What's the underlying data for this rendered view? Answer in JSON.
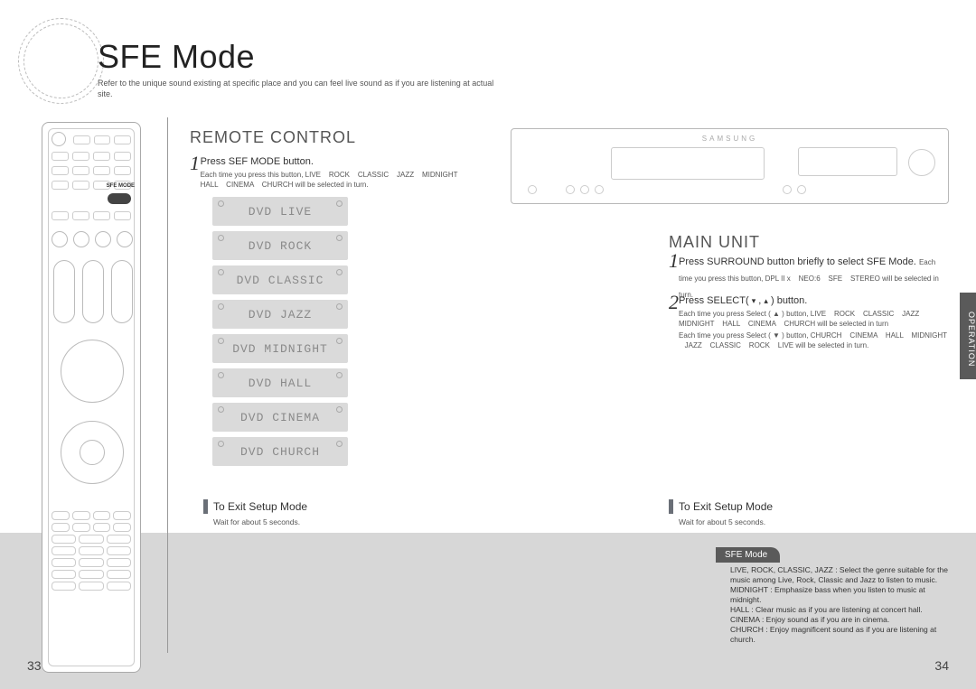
{
  "header": {
    "title": "SFE Mode",
    "subtitle": "Refer to the unique sound existing at specific place and you can feel live sound as if you are listening at actual site."
  },
  "remote_control": {
    "heading": "REMOTE CONTROL",
    "step1": {
      "num": "1",
      "text": "Press SEF MODE button.",
      "detail": "Each time you press this button, LIVE    ROCK    CLASSIC    JAZZ    MIDNIGHT    HALL    CINEMA    CHURCH will be selected in turn."
    },
    "sfe_button_label": "SFE MODE",
    "lcd": [
      "DVD LIVE",
      "DVD ROCK",
      "DVD CLASSIC",
      "DVD JAZZ",
      "DVD MIDNIGHT",
      "DVD HALL",
      "DVD CINEMA",
      "DVD CHURCH"
    ],
    "exit": {
      "label": "To Exit Setup Mode",
      "note": "Wait for about 5 seconds."
    }
  },
  "main_unit": {
    "heading": "MAIN UNIT",
    "brand": "SAMSUNG",
    "step1": {
      "num": "1",
      "text_a": "Press SURROUND button briefly to select  SFE  Mode. ",
      "text_b": "Each time you press this button, DPL II x    NEO:6    SFE    STEREO will be selected in turn."
    },
    "step2": {
      "num": "2",
      "text": "Press SELECT(       ,       ) button.",
      "detail_a": "Each time you press Select ( ▲ ) button, LIVE    ROCK    CLASSIC    JAZZ    MIDNIGHT    HALL    CINEMA    CHURCH will be selected in turn",
      "detail_b": "Each time you press Select ( ▼ ) button, CHURCH    CINEMA    HALL    MIDNIGHT    JAZZ    CLASSIC    ROCK    LIVE will be selected in turn."
    },
    "exit": {
      "label": "To Exit Setup Mode",
      "note": "Wait for about 5 seconds."
    }
  },
  "sidetab": "OPERATION",
  "info": {
    "tab": "SFE Mode",
    "body": "LIVE, ROCK, CLASSIC, JAZZ  : Select the genre suitable for the music among Live, Rock, Classic and Jazz to listen to music.\nMIDNIGHT : Emphasize bass when you listen to music at midnight.\nHALL : Clear music as if you are listening at concert hall.\nCINEMA : Enjoy sound as if you are in cinema.\nCHURCH : Enjoy magnificent sound as if you are listening at church."
  },
  "pages": {
    "left": "33",
    "right": "34"
  }
}
